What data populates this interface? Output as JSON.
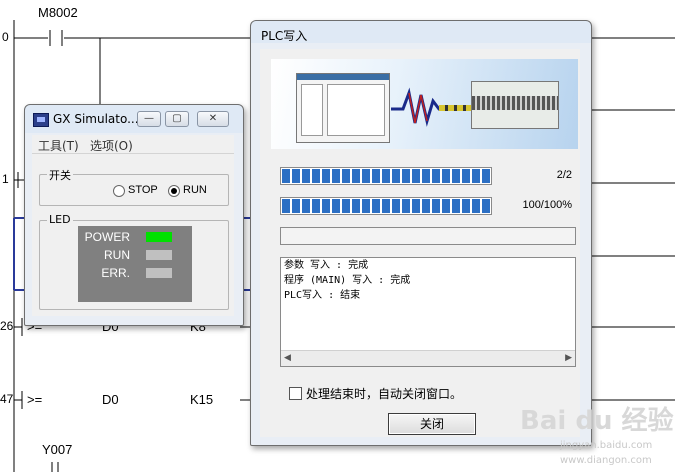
{
  "ladder": {
    "contact_label": "M8002",
    "row_numbers": [
      "0",
      "1",
      "26",
      "47"
    ],
    "rungs": [
      {
        "op": ">=",
        "operand1": "D0",
        "operand2": "K8"
      },
      {
        "op": ">=",
        "operand1": "D0",
        "operand2": "K15"
      }
    ],
    "output_label": "Y007"
  },
  "plc_dialog": {
    "title": "PLC写入",
    "progress1": {
      "value": 1.0,
      "label": "2/2"
    },
    "progress2": {
      "value": 1.0,
      "label": "100/100%"
    },
    "log_lines": [
      "参数 写入 : 完成",
      "程序 (MAIN) 写入 : 完成",
      "PLC写入 : 结束"
    ],
    "auto_close_label": "处理结束时，自动关闭窗口。",
    "auto_close_checked": false,
    "close_button": "关闭"
  },
  "gx_window": {
    "title": "GX Simulato...",
    "menu": [
      "工具(T)",
      "选项(O)"
    ],
    "mode_group": "开关",
    "modes": [
      {
        "label": "STOP",
        "selected": false
      },
      {
        "label": "RUN",
        "selected": true
      }
    ],
    "led_group": "LED",
    "leds": [
      {
        "label": "POWER",
        "color": "#00e000"
      },
      {
        "label": "RUN",
        "color": "#c0c0c0"
      },
      {
        "label": "ERR.",
        "color": "#c0c0c0"
      }
    ]
  },
  "watermark": {
    "brand": "Bai du 经验",
    "url1": "jingyan.baidu.com",
    "url2": "www.diangon.com"
  }
}
